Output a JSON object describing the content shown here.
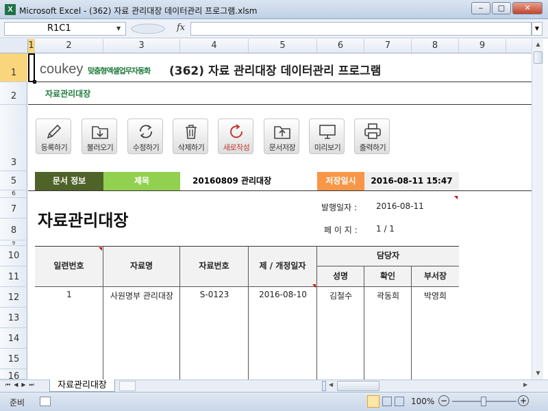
{
  "window": {
    "title": "Microsoft Excel - (362) 자료 관리대장 데이터관리 프로그램.xlsm",
    "app_icon": "X",
    "min": "‒",
    "max": "□",
    "close": "✕"
  },
  "formula": {
    "namebox": "R1C1",
    "fx": "fx",
    "value": ""
  },
  "columns": [
    "1",
    "2",
    "3",
    "4",
    "5",
    "6",
    "7",
    "8",
    "9"
  ],
  "rows": [
    "1",
    "2",
    "3",
    "5",
    "6",
    "7",
    "8",
    "9",
    "10",
    "11",
    "12",
    "13",
    "14",
    "15",
    "16"
  ],
  "header": {
    "brand": "coukey",
    "brand_sub": "맞춤형엑셀업무자동화",
    "program_title": "(362) 자료 관리대장 데이터관리 프로그램",
    "subtitle": "자료관리대장"
  },
  "toolbar": [
    "등록하기",
    "불러오기",
    "수정하기",
    "삭제하기",
    "새로작성",
    "문서저장",
    "미리보기",
    "출력하기"
  ],
  "doc_info": {
    "label": "문서 정보",
    "title_label": "제목",
    "title_value": "20160809 관리대장",
    "saved_label": "저장일시",
    "saved_value": "2016-08-11 15:47"
  },
  "document": {
    "heading": "자료관리대장",
    "issue_label": "발행일자 :",
    "issue_date": "2016-08-11",
    "page_label": "페 이 지 :",
    "page_value": "1 / 1"
  },
  "table": {
    "headers": {
      "serial": "일련번호",
      "name": "자료명",
      "code": "자료번호",
      "revision": "제 / 개정일자",
      "manager": "담당자",
      "person": "성명",
      "confirm": "확인",
      "dept_head": "부서장"
    },
    "rows": [
      {
        "serial": "1",
        "name": "사원명부 관리대장",
        "code": "S-0123",
        "date": "2016-08-10",
        "person": "김철수",
        "confirm": "곽동희",
        "dept_head": "박영희"
      }
    ]
  },
  "sheet": {
    "tab": "자료관리대장"
  },
  "status": {
    "ready": "준비",
    "zoom": "100%"
  },
  "colors": {
    "green_dark": "#4f6228",
    "green_light": "#92d050",
    "orange": "#f79646",
    "brand": "#1f7a3c"
  }
}
